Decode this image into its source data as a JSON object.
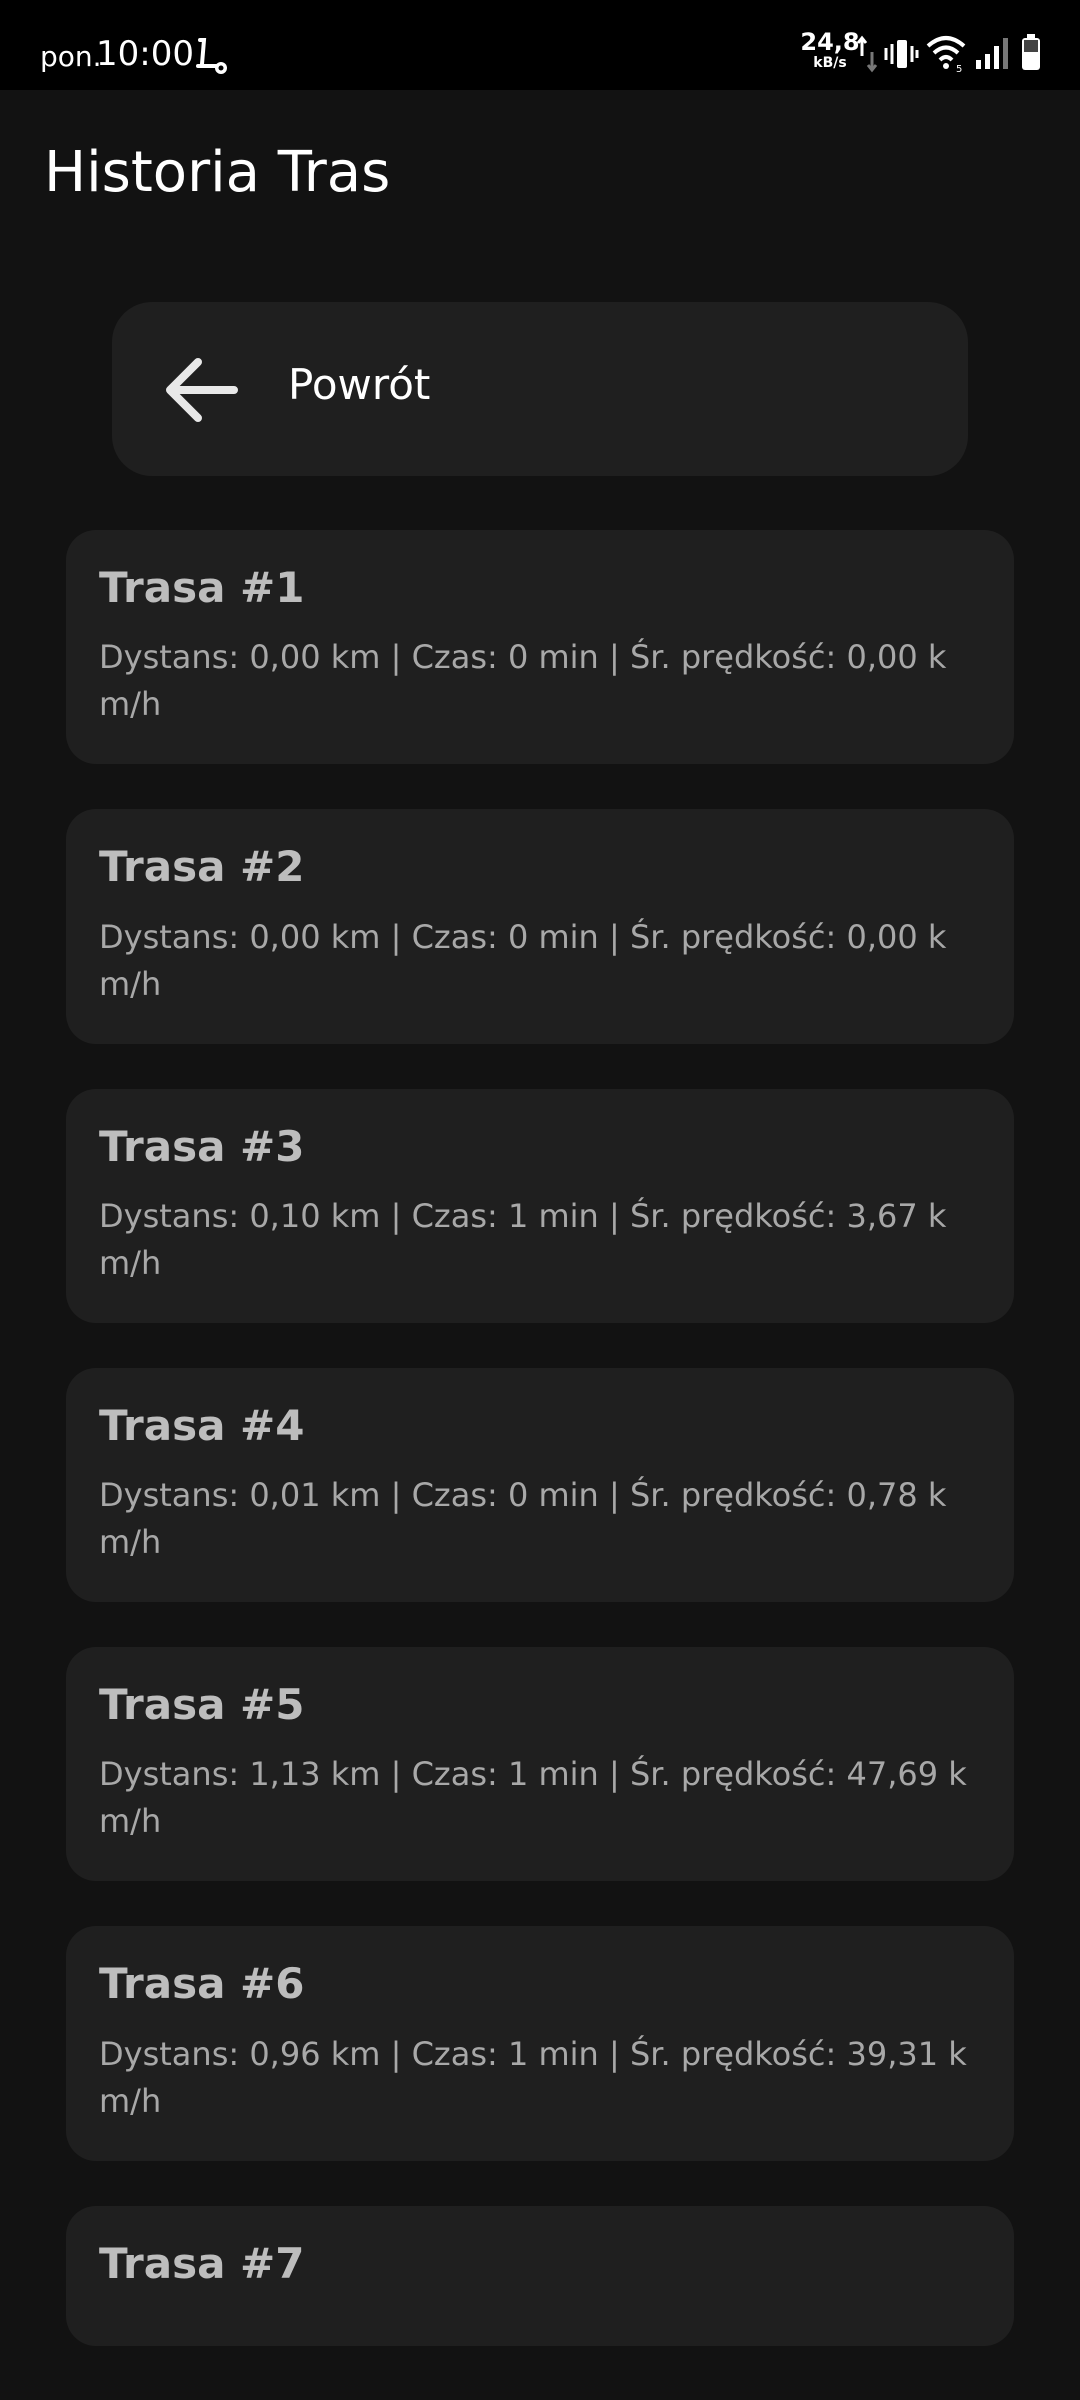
{
  "status_bar": {
    "day": "pon.",
    "time": "10:00",
    "net_speed_value": "24,8",
    "net_speed_unit": "kB/s",
    "icons": [
      "scooter-icon",
      "data-arrows-icon",
      "vibrate-icon",
      "wifi-icon",
      "signal-icon",
      "battery-icon"
    ]
  },
  "header": {
    "title": "Historia Tras"
  },
  "back_button": {
    "label": "Powrót",
    "icon": "arrow-left-icon"
  },
  "routes": [
    {
      "title": "Trasa #1",
      "details": "Dystans: 0,00 km | Czas: 0 min | Śr. prędkość: 0,00 km/h"
    },
    {
      "title": "Trasa #2",
      "details": "Dystans: 0,00 km | Czas: 0 min | Śr. prędkość: 0,00 km/h"
    },
    {
      "title": "Trasa #3",
      "details": "Dystans: 0,10 km | Czas: 1 min | Śr. prędkość: 3,67 km/h"
    },
    {
      "title": "Trasa #4",
      "details": "Dystans: 0,01 km | Czas: 0 min | Śr. prędkość: 0,78 km/h"
    },
    {
      "title": "Trasa #5",
      "details": "Dystans: 1,13 km | Czas: 1 min | Śr. prędkość: 47,69 km/h"
    },
    {
      "title": "Trasa #6",
      "details": "Dystans: 0,96 km | Czas: 1 min | Śr. prędkość: 39,31 km/h"
    },
    {
      "title": "Trasa #7",
      "details": ""
    }
  ],
  "colors": {
    "background": "#121212",
    "card": "#1f1f1f",
    "status_bar": "#000000",
    "title_text": "#ffffff",
    "card_title": "#bdbdbd",
    "card_text": "#a8a8a8"
  }
}
